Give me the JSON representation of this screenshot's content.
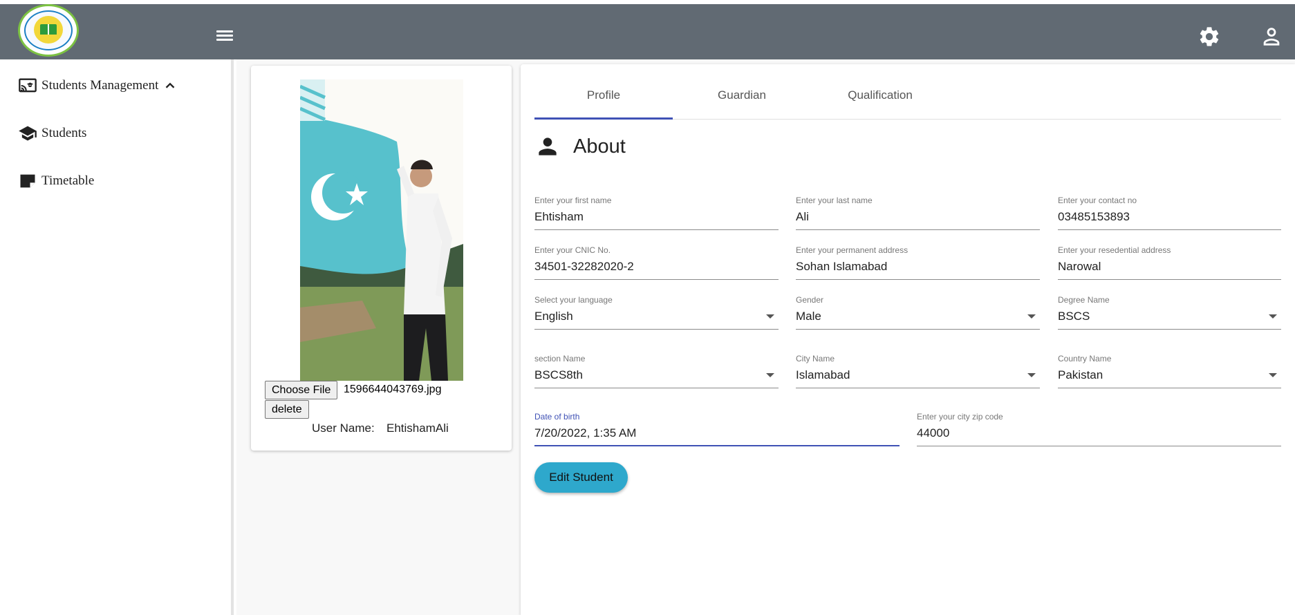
{
  "header": {
    "menu_icon": "hamburger-menu-icon",
    "settings_icon": "gear-icon",
    "account_icon": "person-icon"
  },
  "sidebar": {
    "items": [
      {
        "label": "Students Management",
        "icon": "cast-for-education-icon",
        "expanded": true
      },
      {
        "label": "Students",
        "icon": "graduation-cap-icon"
      },
      {
        "label": "Timetable",
        "icon": "note-icon"
      }
    ]
  },
  "profile_card": {
    "choose_file_label": "Choose File",
    "file_name": "1596644043769.jpg",
    "delete_label": "delete",
    "username_label": "User Name:",
    "username_value": "EhtishamAli"
  },
  "tabs": [
    {
      "label": "Profile",
      "active": true
    },
    {
      "label": "Guardian",
      "active": false
    },
    {
      "label": "Qualification",
      "active": false
    }
  ],
  "about": {
    "title": "About",
    "icon": "person-icon"
  },
  "fields": {
    "first_name": {
      "label": "Enter your first name",
      "value": "Ehtisham"
    },
    "last_name": {
      "label": "Enter your last name",
      "value": "Ali"
    },
    "contact": {
      "label": "Enter your contact no",
      "value": "03485153893"
    },
    "cnic": {
      "label": "Enter your CNIC No.",
      "value": "34501-32282020-2"
    },
    "permanent_address": {
      "label": "Enter your permanent address",
      "value": "Sohan Islamabad"
    },
    "residential_address": {
      "label": "Enter your resedential address",
      "value": "Narowal"
    },
    "language": {
      "label": "Select your language",
      "value": "English"
    },
    "gender": {
      "label": "Gender",
      "value": "Male"
    },
    "degree": {
      "label": "Degree Name",
      "value": "BSCS"
    },
    "section": {
      "label": "section Name",
      "value": "BSCS8th"
    },
    "city": {
      "label": "City Name",
      "value": "Islamabad"
    },
    "country": {
      "label": "Country Name",
      "value": "Pakistan"
    },
    "dob": {
      "label": "Date of birth",
      "value": "7/20/2022, 1:35 AM"
    },
    "zip": {
      "label": "Enter your city zip code",
      "value": "44000"
    }
  },
  "actions": {
    "edit_label": "Edit Student"
  },
  "colors": {
    "topbar": "#616a73",
    "accent": "#3f51b5",
    "button": "#2ea8cc"
  }
}
